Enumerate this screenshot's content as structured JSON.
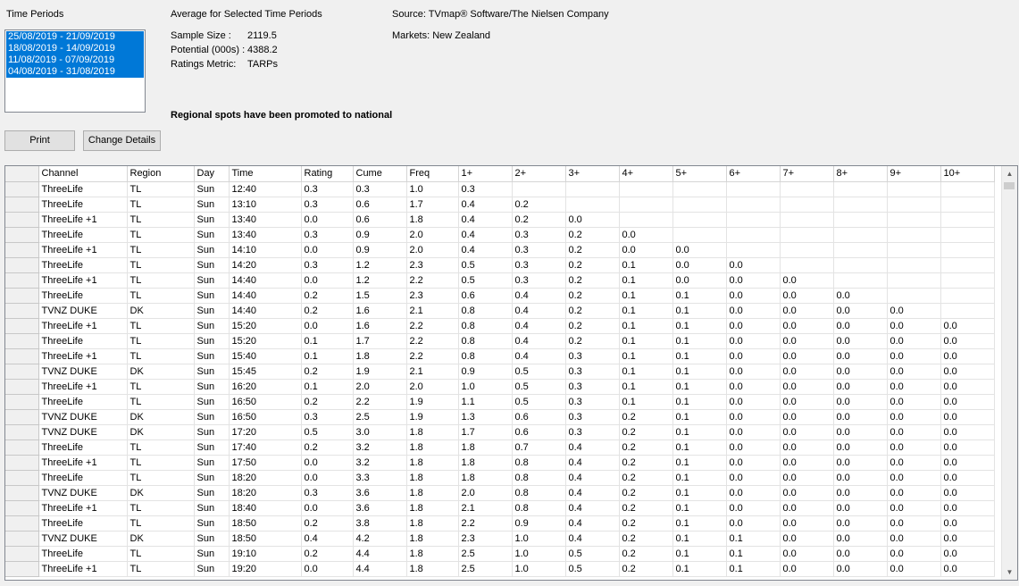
{
  "time_periods": {
    "label": "Time Periods",
    "items": [
      "25/08/2019 - 21/09/2019",
      "18/08/2019 - 14/09/2019",
      "11/08/2019 - 07/09/2019",
      "04/08/2019 - 31/08/2019"
    ]
  },
  "averages": {
    "title": "Average for Selected Time Periods",
    "sample_size_label": "Sample Size :",
    "sample_size_value": "2119.5",
    "potential_label": "Potential (000s) :",
    "potential_value": "4388.2",
    "ratings_metric_label": "Ratings Metric:",
    "ratings_metric_value": "TARPs"
  },
  "source": "Source: TVmap® Software/The Nielsen Company",
  "markets": "Markets: New Zealand",
  "notice": "Regional spots have been promoted to national",
  "buttons": {
    "print": "Print",
    "change_details": "Change Details"
  },
  "table": {
    "columns": [
      "Channel",
      "Region",
      "Day",
      "Time",
      "Rating",
      "Cume",
      "Freq",
      "1+",
      "2+",
      "3+",
      "4+",
      "5+",
      "6+",
      "7+",
      "8+",
      "9+",
      "10+"
    ],
    "rows": [
      [
        "ThreeLife",
        "TL",
        "Sun",
        "12:40",
        "0.3",
        "0.3",
        "1.0",
        "0.3",
        "",
        "",
        "",
        "",
        "",
        "",
        "",
        "",
        ""
      ],
      [
        "ThreeLife",
        "TL",
        "Sun",
        "13:10",
        "0.3",
        "0.6",
        "1.7",
        "0.4",
        "0.2",
        "",
        "",
        "",
        "",
        "",
        "",
        "",
        ""
      ],
      [
        "ThreeLife +1",
        "TL",
        "Sun",
        "13:40",
        "0.0",
        "0.6",
        "1.8",
        "0.4",
        "0.2",
        "0.0",
        "",
        "",
        "",
        "",
        "",
        "",
        ""
      ],
      [
        "ThreeLife",
        "TL",
        "Sun",
        "13:40",
        "0.3",
        "0.9",
        "2.0",
        "0.4",
        "0.3",
        "0.2",
        "0.0",
        "",
        "",
        "",
        "",
        "",
        ""
      ],
      [
        "ThreeLife +1",
        "TL",
        "Sun",
        "14:10",
        "0.0",
        "0.9",
        "2.0",
        "0.4",
        "0.3",
        "0.2",
        "0.0",
        "0.0",
        "",
        "",
        "",
        "",
        ""
      ],
      [
        "ThreeLife",
        "TL",
        "Sun",
        "14:20",
        "0.3",
        "1.2",
        "2.3",
        "0.5",
        "0.3",
        "0.2",
        "0.1",
        "0.0",
        "0.0",
        "",
        "",
        "",
        ""
      ],
      [
        "ThreeLife +1",
        "TL",
        "Sun",
        "14:40",
        "0.0",
        "1.2",
        "2.2",
        "0.5",
        "0.3",
        "0.2",
        "0.1",
        "0.0",
        "0.0",
        "0.0",
        "",
        "",
        ""
      ],
      [
        "ThreeLife",
        "TL",
        "Sun",
        "14:40",
        "0.2",
        "1.5",
        "2.3",
        "0.6",
        "0.4",
        "0.2",
        "0.1",
        "0.1",
        "0.0",
        "0.0",
        "0.0",
        "",
        ""
      ],
      [
        "TVNZ DUKE",
        "DK",
        "Sun",
        "14:40",
        "0.2",
        "1.6",
        "2.1",
        "0.8",
        "0.4",
        "0.2",
        "0.1",
        "0.1",
        "0.0",
        "0.0",
        "0.0",
        "0.0",
        ""
      ],
      [
        "ThreeLife +1",
        "TL",
        "Sun",
        "15:20",
        "0.0",
        "1.6",
        "2.2",
        "0.8",
        "0.4",
        "0.2",
        "0.1",
        "0.1",
        "0.0",
        "0.0",
        "0.0",
        "0.0",
        "0.0"
      ],
      [
        "ThreeLife",
        "TL",
        "Sun",
        "15:20",
        "0.1",
        "1.7",
        "2.2",
        "0.8",
        "0.4",
        "0.2",
        "0.1",
        "0.1",
        "0.0",
        "0.0",
        "0.0",
        "0.0",
        "0.0"
      ],
      [
        "ThreeLife +1",
        "TL",
        "Sun",
        "15:40",
        "0.1",
        "1.8",
        "2.2",
        "0.8",
        "0.4",
        "0.3",
        "0.1",
        "0.1",
        "0.0",
        "0.0",
        "0.0",
        "0.0",
        "0.0"
      ],
      [
        "TVNZ DUKE",
        "DK",
        "Sun",
        "15:45",
        "0.2",
        "1.9",
        "2.1",
        "0.9",
        "0.5",
        "0.3",
        "0.1",
        "0.1",
        "0.0",
        "0.0",
        "0.0",
        "0.0",
        "0.0"
      ],
      [
        "ThreeLife +1",
        "TL",
        "Sun",
        "16:20",
        "0.1",
        "2.0",
        "2.0",
        "1.0",
        "0.5",
        "0.3",
        "0.1",
        "0.1",
        "0.0",
        "0.0",
        "0.0",
        "0.0",
        "0.0"
      ],
      [
        "ThreeLife",
        "TL",
        "Sun",
        "16:50",
        "0.2",
        "2.2",
        "1.9",
        "1.1",
        "0.5",
        "0.3",
        "0.1",
        "0.1",
        "0.0",
        "0.0",
        "0.0",
        "0.0",
        "0.0"
      ],
      [
        "TVNZ DUKE",
        "DK",
        "Sun",
        "16:50",
        "0.3",
        "2.5",
        "1.9",
        "1.3",
        "0.6",
        "0.3",
        "0.2",
        "0.1",
        "0.0",
        "0.0",
        "0.0",
        "0.0",
        "0.0"
      ],
      [
        "TVNZ DUKE",
        "DK",
        "Sun",
        "17:20",
        "0.5",
        "3.0",
        "1.8",
        "1.7",
        "0.6",
        "0.3",
        "0.2",
        "0.1",
        "0.0",
        "0.0",
        "0.0",
        "0.0",
        "0.0"
      ],
      [
        "ThreeLife",
        "TL",
        "Sun",
        "17:40",
        "0.2",
        "3.2",
        "1.8",
        "1.8",
        "0.7",
        "0.4",
        "0.2",
        "0.1",
        "0.0",
        "0.0",
        "0.0",
        "0.0",
        "0.0"
      ],
      [
        "ThreeLife +1",
        "TL",
        "Sun",
        "17:50",
        "0.0",
        "3.2",
        "1.8",
        "1.8",
        "0.8",
        "0.4",
        "0.2",
        "0.1",
        "0.0",
        "0.0",
        "0.0",
        "0.0",
        "0.0"
      ],
      [
        "ThreeLife",
        "TL",
        "Sun",
        "18:20",
        "0.0",
        "3.3",
        "1.8",
        "1.8",
        "0.8",
        "0.4",
        "0.2",
        "0.1",
        "0.0",
        "0.0",
        "0.0",
        "0.0",
        "0.0"
      ],
      [
        "TVNZ DUKE",
        "DK",
        "Sun",
        "18:20",
        "0.3",
        "3.6",
        "1.8",
        "2.0",
        "0.8",
        "0.4",
        "0.2",
        "0.1",
        "0.0",
        "0.0",
        "0.0",
        "0.0",
        "0.0"
      ],
      [
        "ThreeLife +1",
        "TL",
        "Sun",
        "18:40",
        "0.0",
        "3.6",
        "1.8",
        "2.1",
        "0.8",
        "0.4",
        "0.2",
        "0.1",
        "0.0",
        "0.0",
        "0.0",
        "0.0",
        "0.0"
      ],
      [
        "ThreeLife",
        "TL",
        "Sun",
        "18:50",
        "0.2",
        "3.8",
        "1.8",
        "2.2",
        "0.9",
        "0.4",
        "0.2",
        "0.1",
        "0.0",
        "0.0",
        "0.0",
        "0.0",
        "0.0"
      ],
      [
        "TVNZ DUKE",
        "DK",
        "Sun",
        "18:50",
        "0.4",
        "4.2",
        "1.8",
        "2.3",
        "1.0",
        "0.4",
        "0.2",
        "0.1",
        "0.1",
        "0.0",
        "0.0",
        "0.0",
        "0.0"
      ],
      [
        "ThreeLife",
        "TL",
        "Sun",
        "19:10",
        "0.2",
        "4.4",
        "1.8",
        "2.5",
        "1.0",
        "0.5",
        "0.2",
        "0.1",
        "0.1",
        "0.0",
        "0.0",
        "0.0",
        "0.0"
      ],
      [
        "ThreeLife +1",
        "TL",
        "Sun",
        "19:20",
        "0.0",
        "4.4",
        "1.8",
        "2.5",
        "1.0",
        "0.5",
        "0.2",
        "0.1",
        "0.1",
        "0.0",
        "0.0",
        "0.0",
        "0.0"
      ]
    ]
  },
  "scrollbar": {
    "up_icon": "arrow-up-icon",
    "down_icon": "arrow-down-icon"
  },
  "colors": {
    "selection": "#0078d7",
    "window": "#f0f0f0"
  }
}
